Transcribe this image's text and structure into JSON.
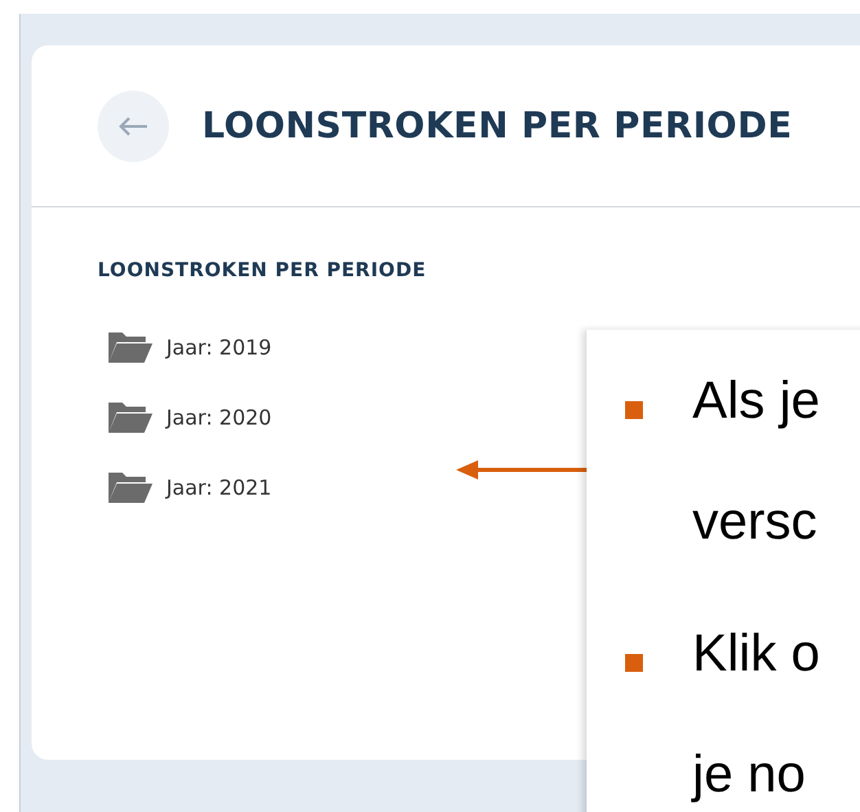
{
  "header": {
    "title": "LOONSTROKEN PER PERIODE"
  },
  "section": {
    "heading": "LOONSTROKEN PER PERIODE",
    "folders": [
      {
        "label": "Jaar: 2019"
      },
      {
        "label": "Jaar: 2020"
      },
      {
        "label": "Jaar: 2021"
      }
    ]
  },
  "callout": {
    "bullets": [
      {
        "lines": [
          "Als je",
          "versc"
        ]
      },
      {
        "lines": [
          "Klik o",
          "je no"
        ]
      }
    ]
  }
}
